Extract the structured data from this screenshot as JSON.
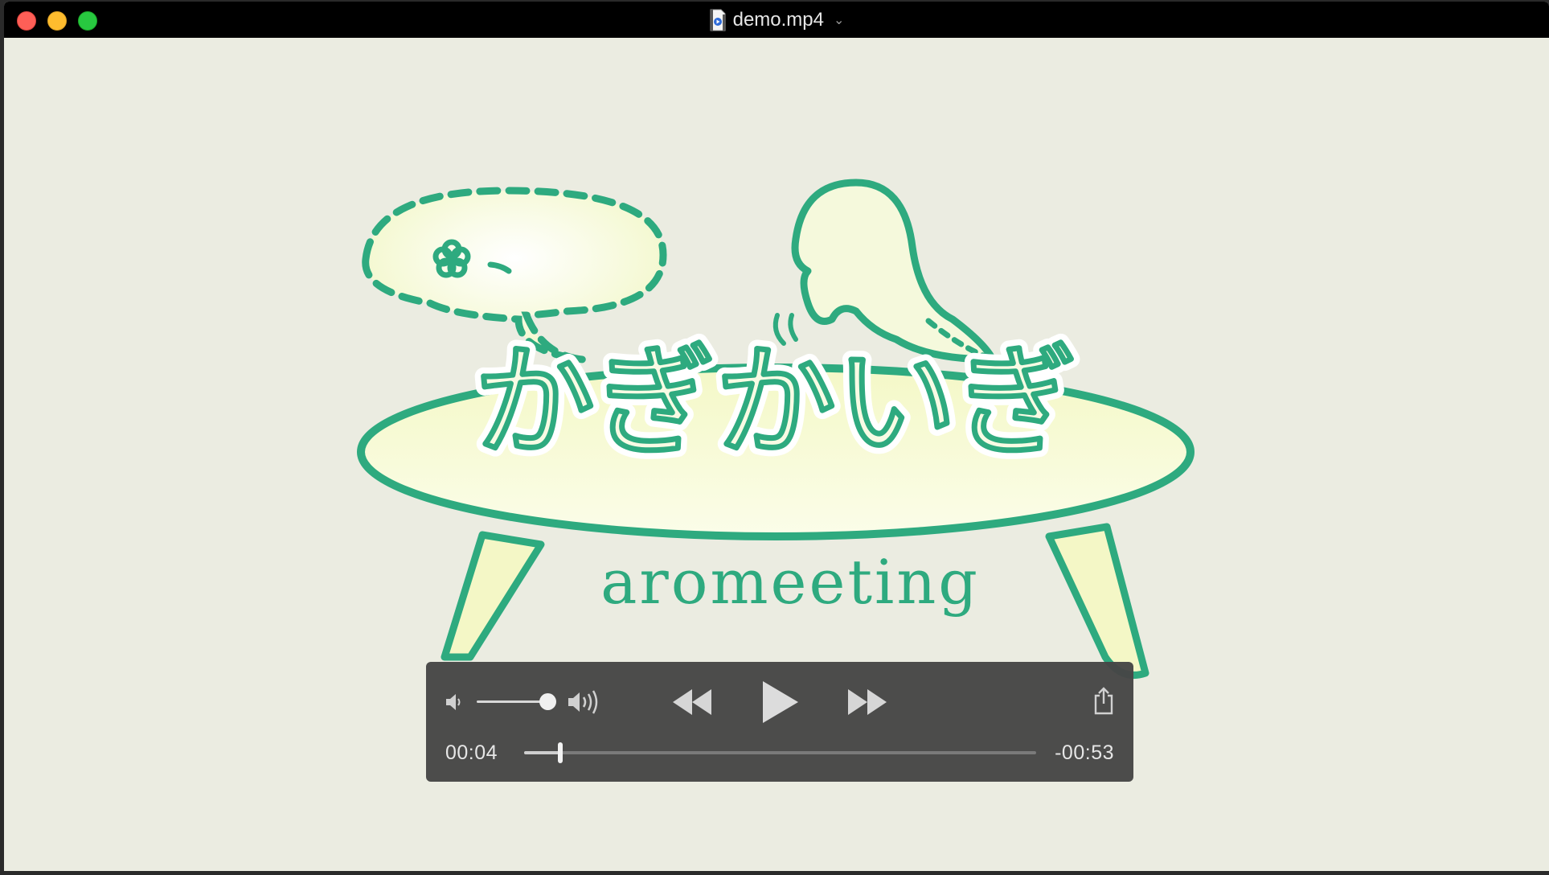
{
  "window": {
    "title": "demo.mp4"
  },
  "video": {
    "logo_text": "かぎかいぎ",
    "tagline": "aromeeting",
    "colors": {
      "background": "#ebece1",
      "green": "#2eaa7f",
      "yellow": "#f4f7c6"
    }
  },
  "player": {
    "elapsed": "00:04",
    "remaining": "-00:53",
    "progress": 0.07,
    "volume": 1.0,
    "icons": {
      "volume_low": "speaker-low-icon",
      "volume_high": "speaker-high-icon",
      "rewind": "rewind-icon",
      "play": "play-icon",
      "fast_forward": "fast-forward-icon",
      "share": "share-icon"
    }
  }
}
